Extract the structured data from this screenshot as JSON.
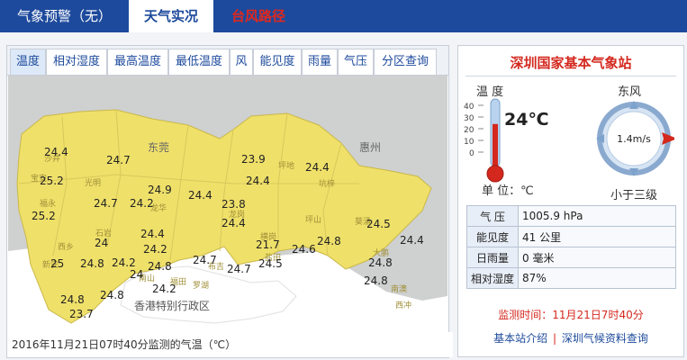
{
  "tabs": [
    {
      "label": "气象预警（无）"
    },
    {
      "label": "天气实况"
    },
    {
      "label": "台风路径"
    }
  ],
  "subtabs": [
    "温度",
    "相对湿度",
    "最高温度",
    "最低温度",
    "风",
    "能见度",
    "雨量",
    "气压",
    "分区查询"
  ],
  "map": {
    "caption": "2016年11月21日07时40分监测的气温（℃）",
    "areas": [
      "东莞",
      "惠州",
      "香港特别行政区"
    ],
    "districts": [
      "宝安",
      "光明",
      "石岩",
      "西乡",
      "新安",
      "南山",
      "福田",
      "罗湖",
      "龙岗",
      "坪山",
      "坑梓",
      "盐田",
      "大鹏",
      "南澳",
      "坪地",
      "龙华",
      "布吉",
      "横岗",
      "葵涌",
      "西冲",
      "福永",
      "沙井"
    ],
    "readings": [
      "24.4",
      "24.7",
      "25.2",
      "25.2",
      "24.7",
      "24.2",
      "24.9",
      "24.4",
      "23.9",
      "24.4",
      "24.4",
      "23.8",
      "24.4",
      "24.5",
      "24.4",
      "24",
      "24.4",
      "24.2",
      "25",
      "24.8",
      "24.8",
      "24.2",
      "24",
      "24.7",
      "24.2",
      "21.7",
      "24.6",
      "24.8",
      "24.7",
      "24.5",
      "24.8",
      "24.8",
      "24.8",
      "23.7",
      "24.8"
    ]
  },
  "station": {
    "title": "深圳国家基本气象站",
    "temp_label": "温  度",
    "temp_value": "24℃",
    "temp_value_c": 24,
    "temp_scale": [
      "40",
      "30",
      "20",
      "10",
      "0"
    ],
    "unit_label": "单  位：℃",
    "wind_dir": "东风",
    "wind_speed": "1.4m/s",
    "wind_level": "小于三级",
    "info": [
      {
        "k": "气  压",
        "v": "1005.9 hPa"
      },
      {
        "k": "能见度",
        "v": "41 公里"
      },
      {
        "k": "日雨量",
        "v": "0 毫米"
      },
      {
        "k": "相对湿度",
        "v": "87%"
      }
    ],
    "monitor_time": "监测时间：11月21日7时40分",
    "link1": "基本站介绍",
    "link_sep": "|",
    "link2": "深圳气候资料查询"
  },
  "colors": {
    "accent_blue": "#1d4a9c",
    "alert_red": "#d4281e",
    "land_yellow": "#efe06a",
    "sea_white": "#ffffff",
    "outside_gray": "#cfd0d0"
  }
}
